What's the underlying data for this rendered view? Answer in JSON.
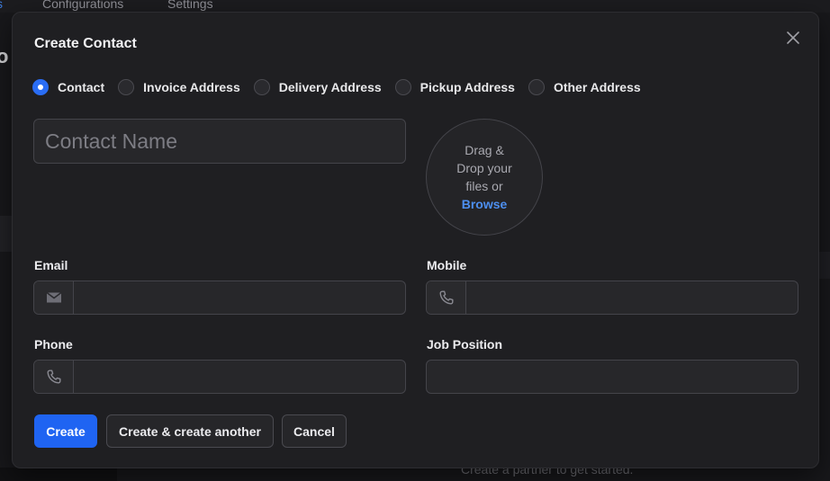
{
  "background": {
    "tabs": [
      "s",
      "Configurations",
      "Settings"
    ],
    "partial_letter": "o",
    "empty_hint": "Create a partner to get started."
  },
  "modal": {
    "title": "Create Contact",
    "close_icon": "close-icon",
    "address_types": [
      {
        "label": "Contact",
        "checked": true
      },
      {
        "label": "Invoice Address",
        "checked": false
      },
      {
        "label": "Delivery Address",
        "checked": false
      },
      {
        "label": "Pickup Address",
        "checked": false
      },
      {
        "label": "Other Address",
        "checked": false
      }
    ],
    "contact_name": {
      "placeholder": "Contact Name",
      "value": ""
    },
    "dropzone": {
      "line1": "Drag &",
      "line2": "Drop your",
      "line3": "files or",
      "browse": "Browse"
    },
    "fields": {
      "email": {
        "label": "Email",
        "value": "",
        "icon": "envelope-icon"
      },
      "mobile": {
        "label": "Mobile",
        "value": "",
        "icon": "phone-icon"
      },
      "phone": {
        "label": "Phone",
        "value": "",
        "icon": "phone-icon"
      },
      "job_position": {
        "label": "Job Position",
        "value": ""
      }
    },
    "buttons": {
      "create": "Create",
      "create_another": "Create & create another",
      "cancel": "Cancel"
    }
  },
  "colors": {
    "accent": "#1f64f2",
    "link": "#4d8ff0",
    "modal_bg": "#1f1f22"
  }
}
